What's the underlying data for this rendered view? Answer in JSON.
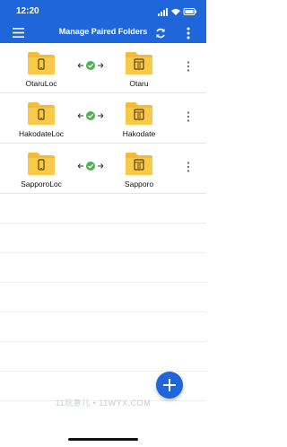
{
  "status_bar": {
    "time": "12:20"
  },
  "app_bar": {
    "title": "Manage Paired Folders"
  },
  "pairs": [
    {
      "local": "OtaruLoc",
      "remote": "Otaru"
    },
    {
      "local": "HakodateLoc",
      "remote": "Hakodate"
    },
    {
      "local": "SapporoLoc",
      "remote": "Sapporo"
    }
  ],
  "watermark": "11玩意儿 • 11WYX.COM",
  "colors": {
    "brand": "#1e66d9",
    "folder": "#f6bb36",
    "check": "#4caf50"
  }
}
